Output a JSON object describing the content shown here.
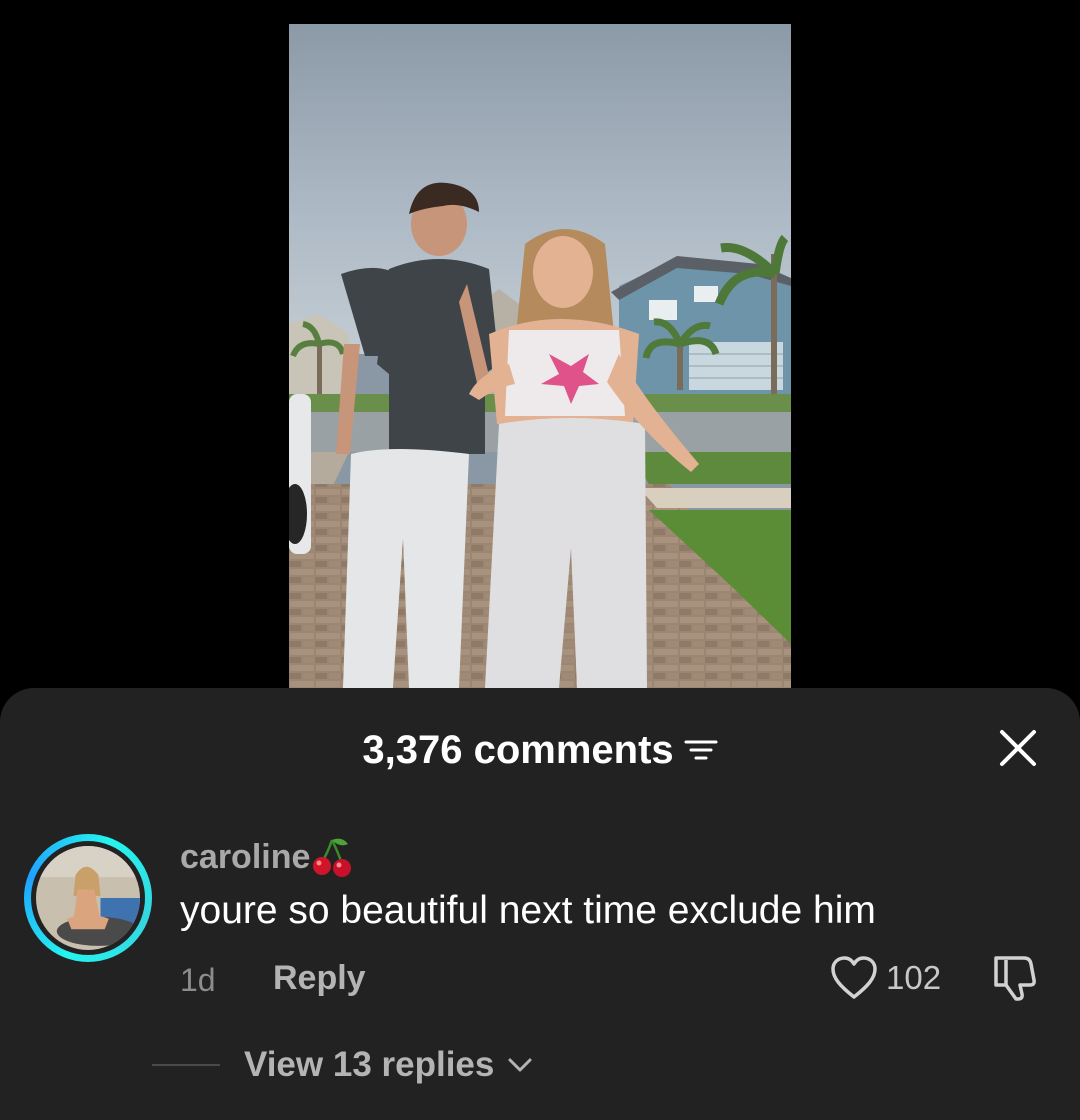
{
  "video": {
    "description_icon": "video-frame"
  },
  "comments_sheet": {
    "title": "3,376 comments",
    "sort_icon": "sort-filter-icon",
    "close_icon": "close-icon"
  },
  "comment": {
    "username": "caroline",
    "username_emoji": "cherry-emoji",
    "text": "youre so beautiful next time exclude him",
    "time": "1d",
    "reply_label": "Reply",
    "likes": "102",
    "replies_label": "View 13 replies",
    "avatar_ring_color": "#25f4ee"
  },
  "colors": {
    "sheet_bg": "#222222",
    "accent_ring": "#25f4ee",
    "primary_text": "#ffffff",
    "secondary_text": "#a9a9a9"
  }
}
